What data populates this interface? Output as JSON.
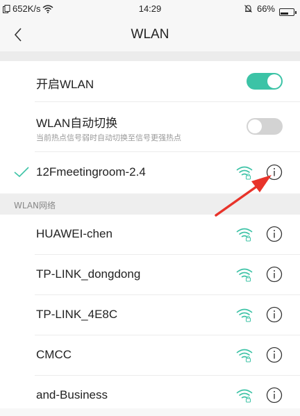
{
  "status_bar": {
    "speed": "652K/s",
    "time": "14:29",
    "battery": "66%",
    "battery_level": 0.66
  },
  "header": {
    "title": "WLAN"
  },
  "settings": {
    "wlan_toggle": {
      "label": "开启WLAN",
      "state": "on"
    },
    "auto_switch": {
      "label": "WLAN自动切换",
      "sublabel": "当前热点信号弱时自动切换至信号更强热点",
      "state": "off"
    }
  },
  "connected": {
    "ssid": "12Fmeetingroom-2.4"
  },
  "section_label": "WLAN网络",
  "networks": [
    {
      "ssid": "HUAWEI-chen"
    },
    {
      "ssid": "TP-LINK_dongdong"
    },
    {
      "ssid": "TP-LINK_4E8C"
    },
    {
      "ssid": "CMCC"
    },
    {
      "ssid": "and-Business"
    }
  ],
  "colors": {
    "accent": "#3cc3a6",
    "annotation_arrow": "#e8332a"
  },
  "icons": {
    "back": "chevron-left-icon",
    "wifi": "wifi-lock-icon",
    "info": "info-circle-icon",
    "check": "checkmark-icon"
  }
}
